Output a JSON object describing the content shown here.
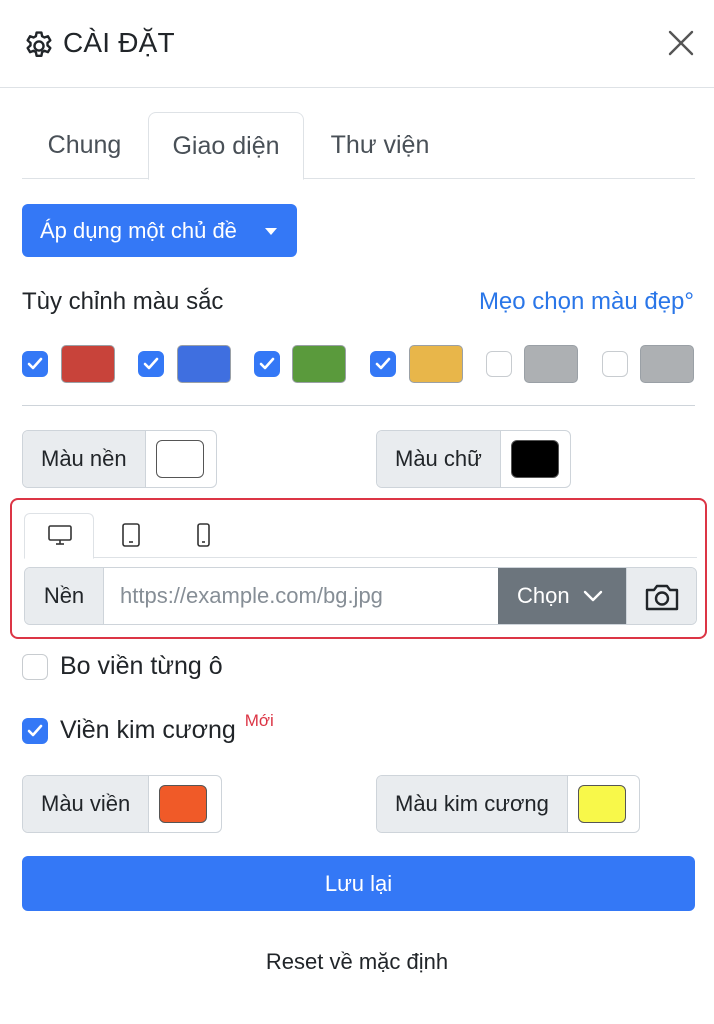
{
  "header": {
    "title": "CÀI ĐẶT",
    "settings_icon": "gear-icon",
    "close_icon": "close-icon"
  },
  "tabs": [
    {
      "label": "Chung",
      "active": false
    },
    {
      "label": "Giao diện",
      "active": true
    },
    {
      "label": "Thư viện",
      "active": false
    }
  ],
  "theme": {
    "apply_label": "Áp dụng một chủ đề"
  },
  "colors": {
    "section_label": "Tùy chỉnh màu sắc",
    "tip_link": "Mẹo chọn màu đẹp°",
    "swatches": [
      {
        "checked": true,
        "color": "#c8433a"
      },
      {
        "checked": true,
        "color": "#3f6fe0"
      },
      {
        "checked": true,
        "color": "#5a9a3c"
      },
      {
        "checked": true,
        "color": "#e8b64a"
      },
      {
        "checked": false,
        "color": "#adb0b3"
      },
      {
        "checked": false,
        "color": "#adb0b3"
      }
    ]
  },
  "background_color": {
    "label": "Màu nền",
    "value": "#ffffff"
  },
  "text_color": {
    "label": "Màu chữ",
    "value": "#000000"
  },
  "bg_image": {
    "devices": [
      {
        "icon": "desktop-icon",
        "active": true
      },
      {
        "icon": "tablet-icon",
        "active": false
      },
      {
        "icon": "phone-icon",
        "active": false
      }
    ],
    "label": "Nền",
    "placeholder": "https://example.com/bg.jpg",
    "choose_label": "Chọn",
    "camera_icon": "camera-icon"
  },
  "options": {
    "cell_border": {
      "label": "Bo viền từng ô",
      "checked": false
    },
    "diamond_border": {
      "label": "Viền kim cương",
      "checked": true,
      "badge": "Mới"
    }
  },
  "border_color": {
    "label": "Màu viền",
    "value": "#f05a28"
  },
  "diamond_color": {
    "label": "Màu kim cương",
    "value": "#f8f84a"
  },
  "actions": {
    "save_label": "Lưu lại",
    "reset_label": "Reset về mặc định"
  },
  "accent_color": "#3478f6"
}
